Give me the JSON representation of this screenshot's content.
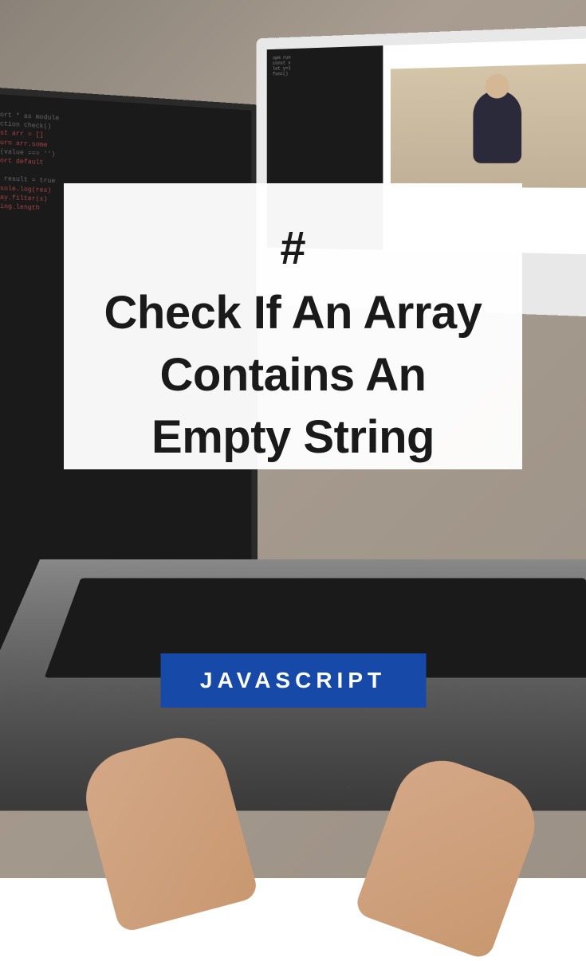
{
  "card": {
    "hash": "#",
    "title": "Check If An Array Contains An Empty String"
  },
  "badge": {
    "label": "JAVASCRIPT"
  }
}
